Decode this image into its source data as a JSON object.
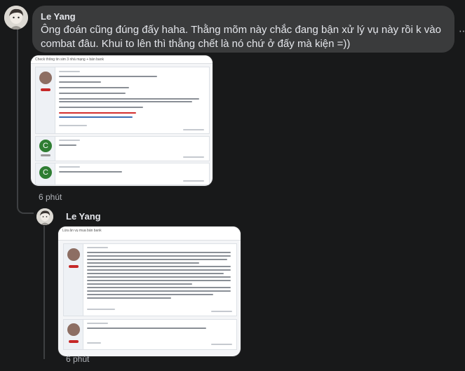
{
  "comment": {
    "author": "Le Yang",
    "text": "Ông đoán cũng đúng đấy haha. Thằng mõm này chắc đang bận xử lý vụ này rồi k vào combat đâu. Khui to lên thì thằng chết là nó chứ ở đấy mà kiện =))",
    "time": "6 phút"
  },
  "reply": {
    "author": "Le Yang",
    "time": "6 phút"
  },
  "attachment_1": {
    "header": "Check thông tin sim 3 nhà mạng + bán bank",
    "user_initial_2": "C",
    "user_initial_3": "C"
  },
  "attachment_2": {
    "header": "Lừa ăn vụ mua bán bank"
  },
  "colors": {
    "background": "#18191a",
    "bubble": "#3a3b3c",
    "text": "#e4e6eb",
    "muted": "#b0b3b8",
    "avatar_green": "#2e7d32",
    "highlight_red": "#d32f2f"
  },
  "icons": {
    "more": "more-dots-icon",
    "avatar_1": "user-avatar",
    "avatar_2": "user-avatar"
  }
}
